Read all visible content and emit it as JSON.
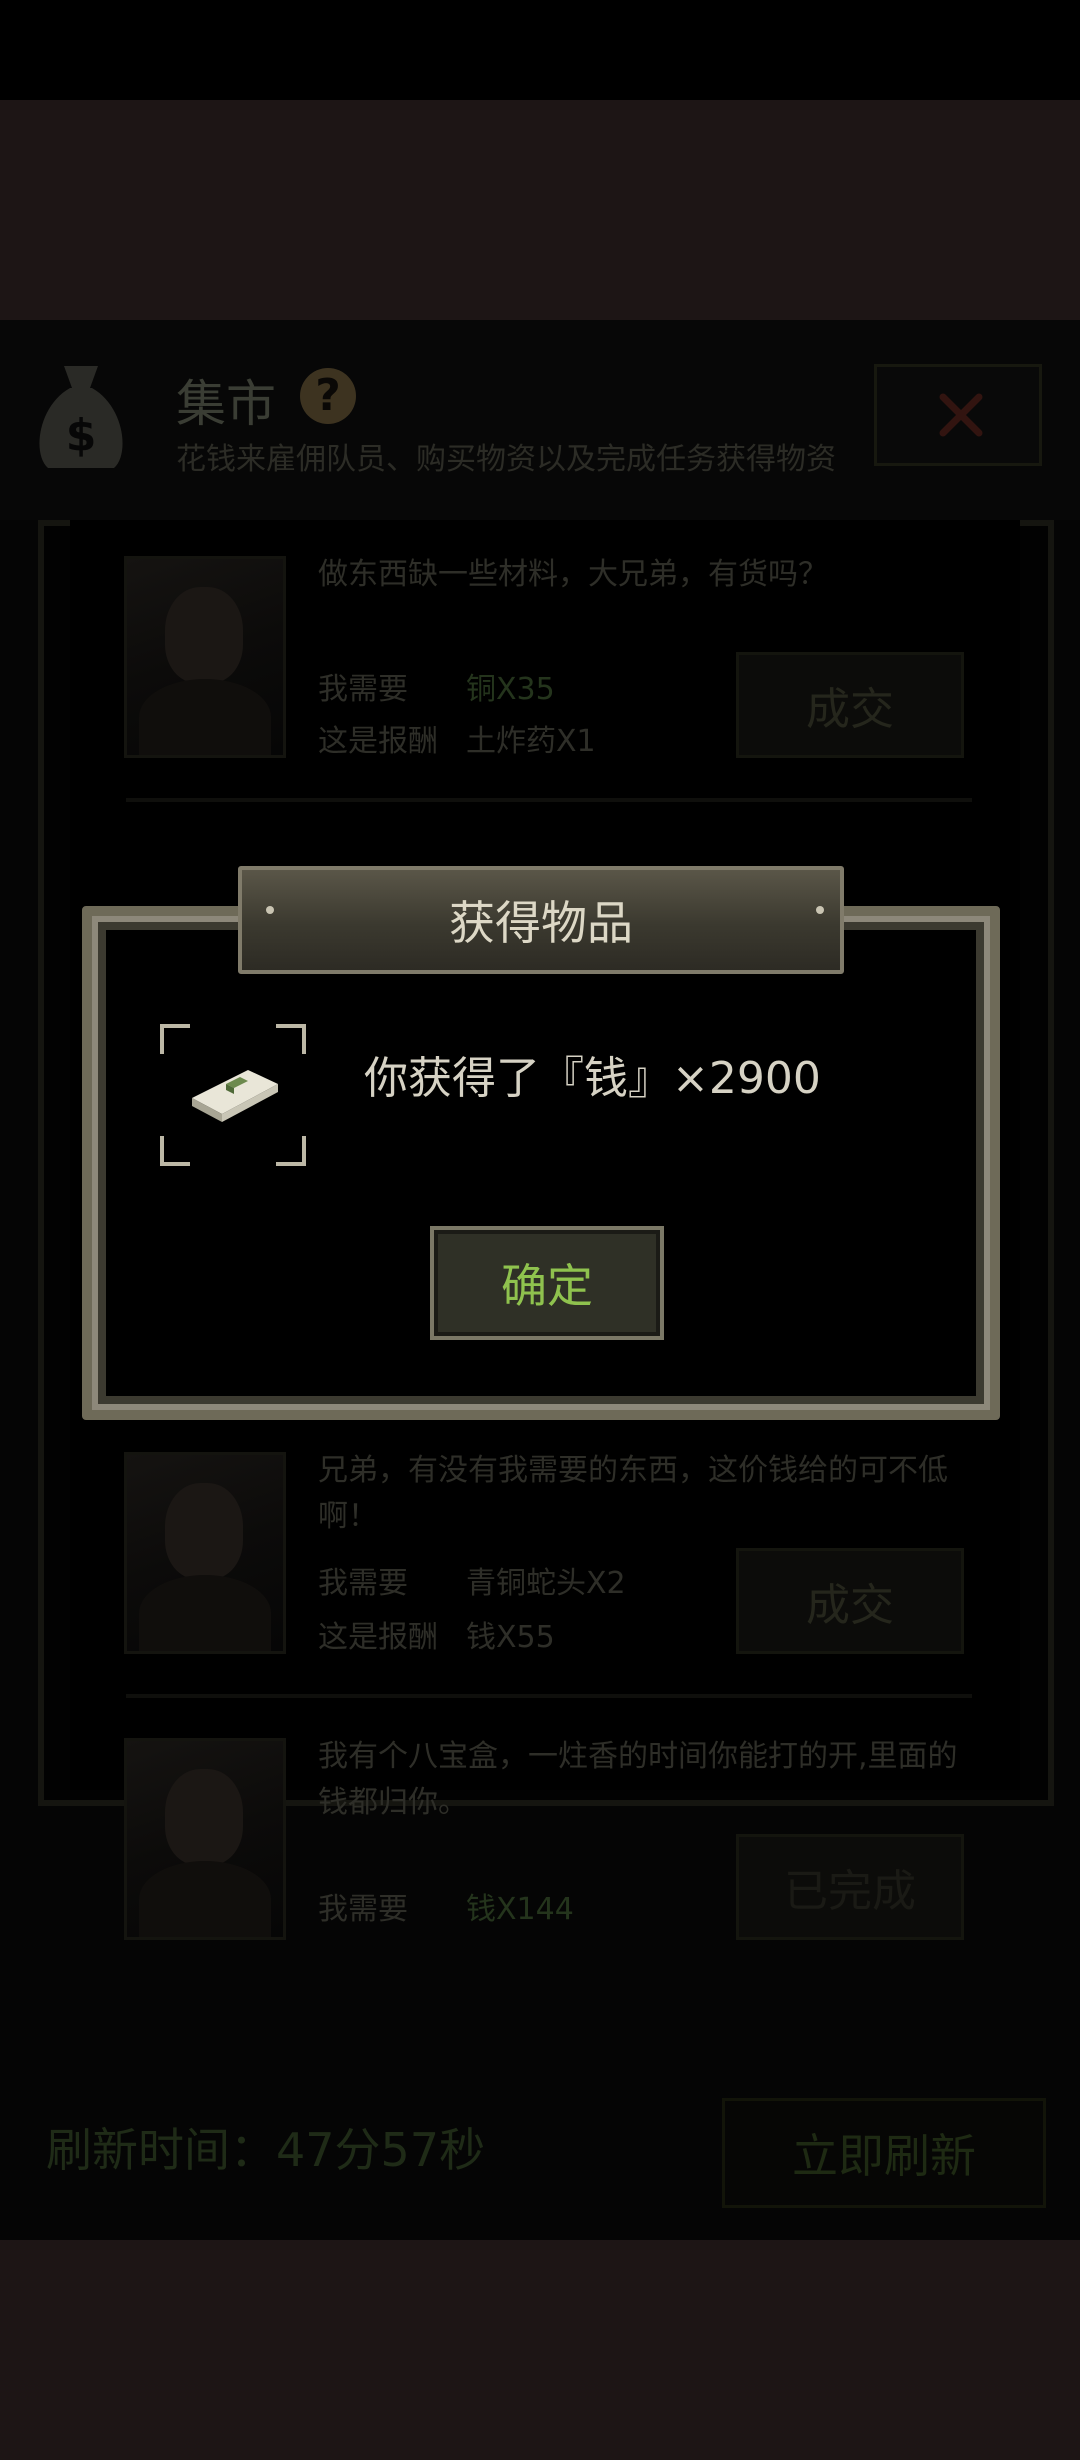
{
  "market": {
    "title": "集市",
    "help_glyph": "?",
    "subtitle": "花钱来雇佣队员、购买物资以及完成任务获得物资",
    "close_glyph": "✕",
    "need_label": "我需要",
    "reward_label": "这是报酬",
    "quests": [
      {
        "description": "做东西缺一些材料，大兄弟，有货吗？",
        "need": "铜X35",
        "reward": "土炸药X1",
        "button": "成交"
      },
      {
        "description": "兄弟，有没有我需要的东西，这价钱给的可不低啊！",
        "need": "青铜蛇头X2",
        "reward": "钱X55",
        "button": "成交"
      },
      {
        "description": "我有个八宝盒，一炷香的时间你能打的开,里面的钱都归你。",
        "need": "钱X144",
        "button": "已完成"
      }
    ],
    "refresh_time": "刷新时间：47分57秒",
    "refresh_button": "立即刷新"
  },
  "dialog": {
    "title": "获得物品",
    "message": "你获得了『钱』×2900",
    "item_icon": "money-stack-icon",
    "confirm_button": "确定"
  },
  "colors": {
    "confirm_text": "#8fc24e",
    "need_text": "#24341c",
    "dialog_frame": "#6e6a58"
  }
}
